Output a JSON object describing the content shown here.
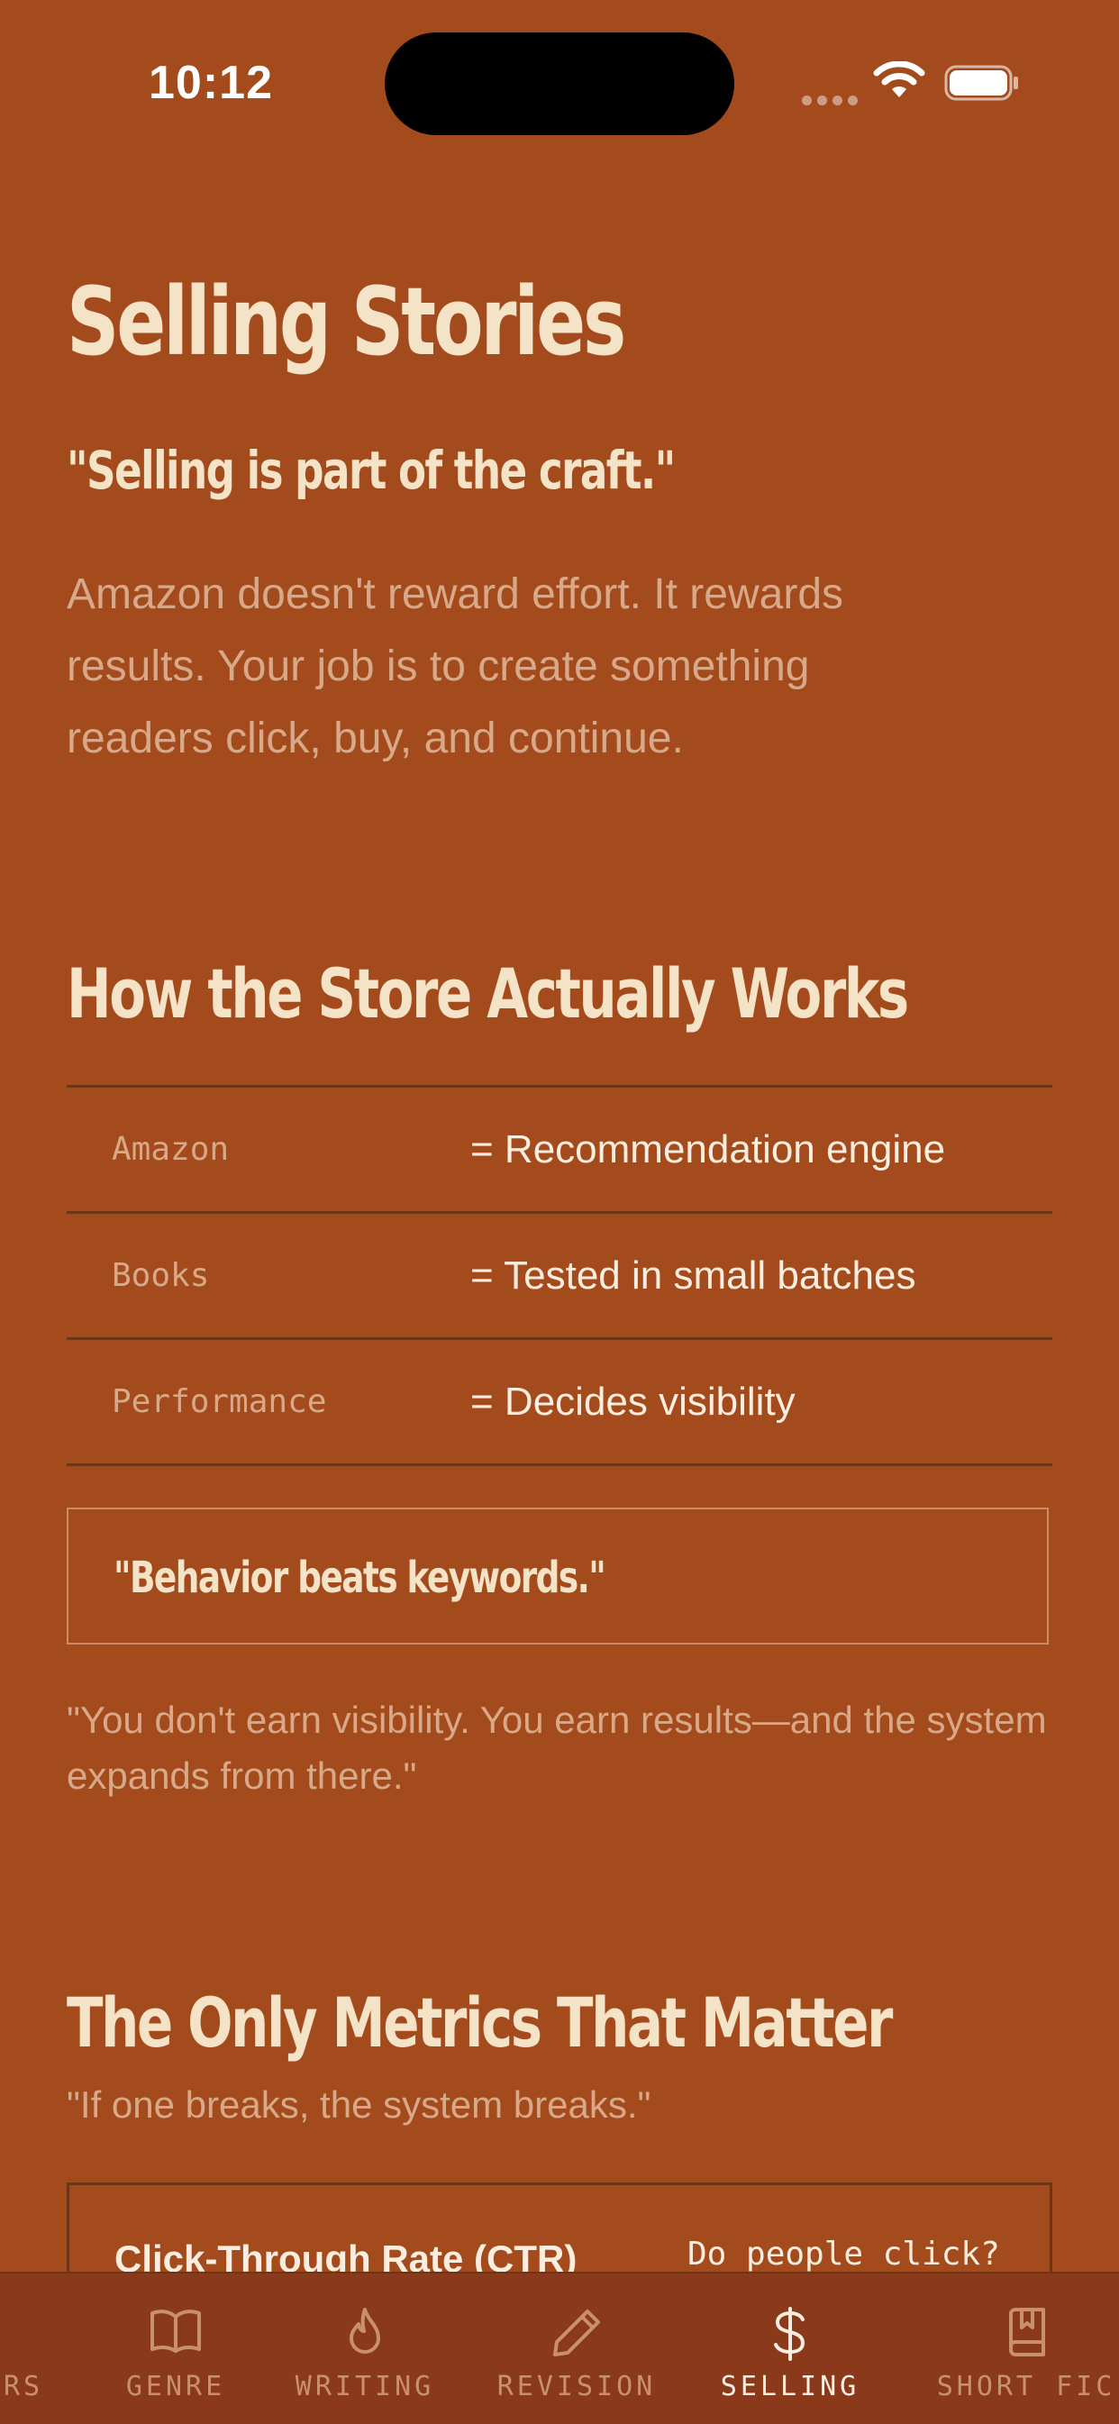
{
  "status_bar": {
    "time": "10:12"
  },
  "header": {
    "title": "Selling Stories",
    "tagline": "\"Selling is part of the craft.\"",
    "intro": "Amazon doesn't reward effort. It rewards results. Your job is to create something readers click, buy, and continue."
  },
  "store_section": {
    "title": "How the Store Actually Works",
    "rows": [
      {
        "key": "Amazon",
        "value": "= Recommendation engine"
      },
      {
        "key": "Books",
        "value": "= Tested in small batches"
      },
      {
        "key": "Performance",
        "value": "= Decides visibility"
      }
    ],
    "quote": "\"Behavior beats keywords.\"",
    "note": "\"You don't earn visibility. You earn results—and the system expands from there.\""
  },
  "metrics_section": {
    "title": "The Only Metrics That Matter",
    "subtitle": "\"If one breaks, the system breaks.\"",
    "cards": [
      {
        "name": "Click-Through Rate (CTR)",
        "question": "Do people click?"
      }
    ]
  },
  "tab_bar": {
    "tabs": [
      {
        "label": "ERS",
        "icon": "none"
      },
      {
        "label": "GENRE",
        "icon": "book-open-icon"
      },
      {
        "label": "WRITING",
        "icon": "flame-icon"
      },
      {
        "label": "REVISION",
        "icon": "pencil-icon"
      },
      {
        "label": "SELLING",
        "icon": "dollar-icon",
        "active": true
      },
      {
        "label": "SHORT FIC",
        "icon": "bookmark-book-icon"
      }
    ]
  },
  "colors": {
    "background": "#a44b1d",
    "tab_bar": "#8a3a1b",
    "heading": "#f5e3c8",
    "muted_text": "#d8a988"
  }
}
